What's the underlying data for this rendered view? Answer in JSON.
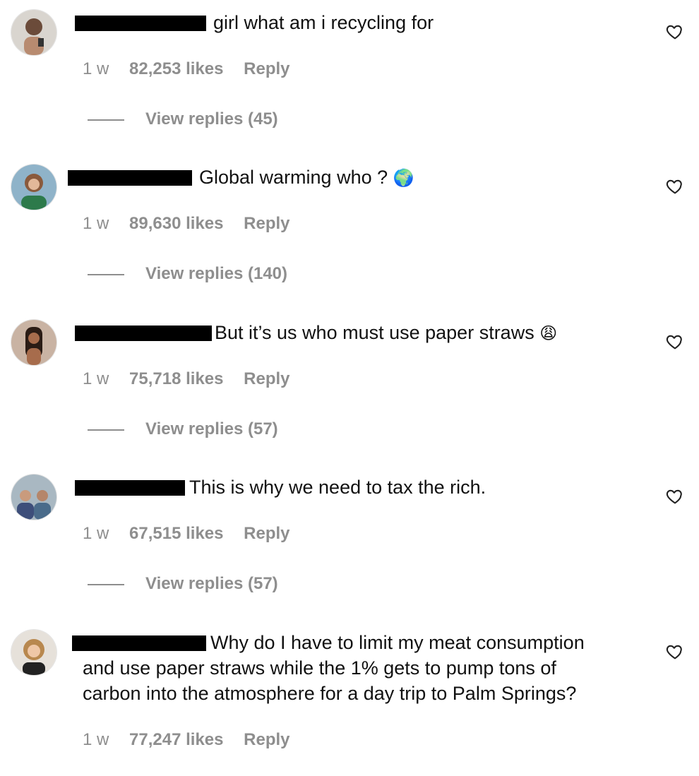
{
  "comments": [
    {
      "text": "girl what am i recycling for",
      "age": "1 w",
      "likes": "82,253 likes",
      "reply": "Reply",
      "view_replies": "View replies (45)",
      "emoji": ""
    },
    {
      "text": "Global warming who ?",
      "age": "1 w",
      "likes": "89,630 likes",
      "reply": "Reply",
      "view_replies": "View replies (140)",
      "emoji": "🌍"
    },
    {
      "text": "But it’s us who must use paper straws",
      "age": "1 w",
      "likes": "75,718 likes",
      "reply": "Reply",
      "view_replies": "View replies (57)",
      "emoji": "😩"
    },
    {
      "text": "This is why we need to tax the rich.",
      "age": "1 w",
      "likes": "67,515 likes",
      "reply": "Reply",
      "view_replies": "View replies (57)",
      "emoji": ""
    },
    {
      "text_line1": "Why do I have to limit my meat consumption",
      "text_line2": "and use paper straws while the 1% gets to pump tons of",
      "text_line3": "carbon into the atmosphere for a day trip to Palm Springs?",
      "age": "1 w",
      "likes": "77,247 likes",
      "reply": "Reply"
    }
  ],
  "icons": {
    "like": "heart-outline-icon",
    "avatar": "user-avatar"
  },
  "colors": {
    "muted": "#8e8e8e",
    "text": "#111111",
    "redaction": "#000000"
  }
}
